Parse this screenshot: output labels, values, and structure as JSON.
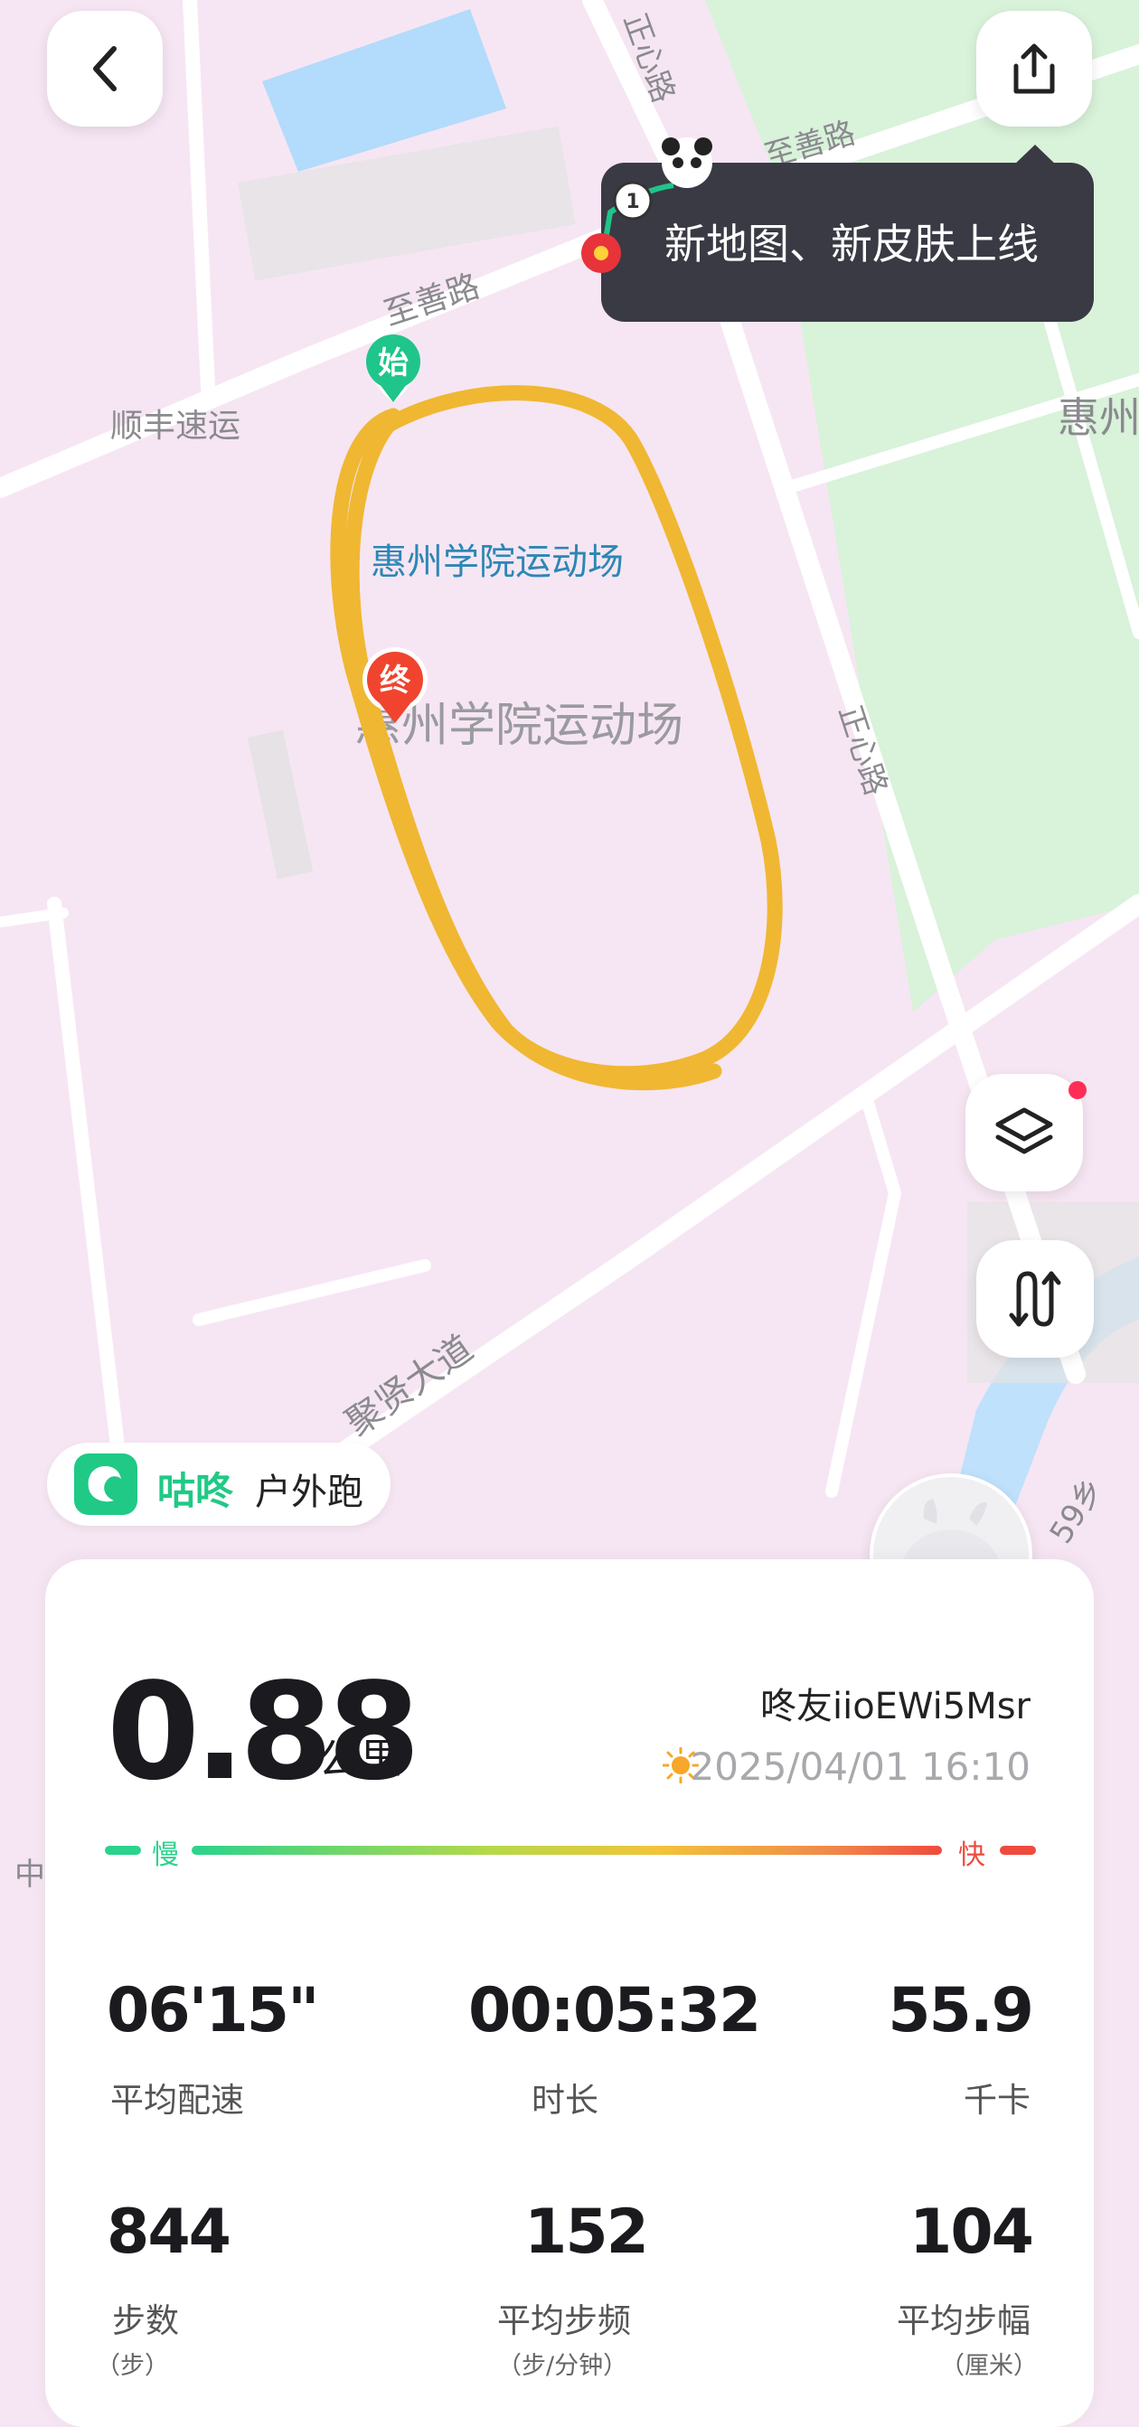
{
  "map": {
    "roads": {
      "zhishan_top": "至善路",
      "zhengxin_top": "正心路",
      "zhishan": "至善路",
      "zhengxin": "正心路",
      "juxian": "聚贤大道",
      "road59": "59乡"
    },
    "pois": {
      "shunfeng": "顺丰速运",
      "huizhou_right": "惠州",
      "stadium_name": "惠州学院运动场",
      "stadium_area": "惠州学院运动场",
      "left_edge": "中"
    },
    "markers": {
      "start": "始",
      "end": "终"
    },
    "route_color": "#f0b733"
  },
  "header": {
    "back_icon": "chevron-left-icon",
    "share_icon": "share-icon"
  },
  "promo": {
    "text": "新地图、新皮肤上线"
  },
  "side_controls": {
    "layers_icon": "layers-icon",
    "route_icon": "route-toggle-icon"
  },
  "brand": {
    "app_name": "咕咚",
    "activity": "户外跑"
  },
  "summary": {
    "distance": "0.88",
    "distance_unit": "公里",
    "username": "咚友iioEWi5Msr",
    "datetime": "2025/04/01 16:10",
    "speed_slow": "慢",
    "speed_fast": "快"
  },
  "stats": [
    {
      "value": "06'15\"",
      "label": "平均配速",
      "sub": ""
    },
    {
      "value": "00:05:32",
      "label": "时长",
      "sub": ""
    },
    {
      "value": "55.9",
      "label": "千卡",
      "sub": ""
    },
    {
      "value": "844",
      "label": "步数",
      "sub": "（步）"
    },
    {
      "value": "152",
      "label": "平均步频",
      "sub": "（步/分钟）"
    },
    {
      "value": "104",
      "label": "平均步幅",
      "sub": "（厘米）"
    }
  ],
  "colors": {
    "brand_green": "#20c986",
    "speed_slow": "#2bd38c",
    "speed_fast": "#ef4a3e",
    "notification_dot": "#ff2d55"
  }
}
